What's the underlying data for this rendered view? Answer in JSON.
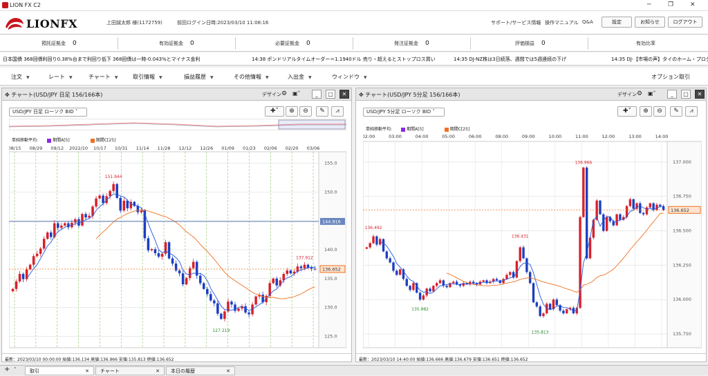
{
  "app": {
    "title": "LION FX C2",
    "brand": "LIONFX"
  },
  "header": {
    "user": "上田誠太郎 様(1172759)",
    "last_login": "前回ログイン日時:2023/03/10 11:08:16",
    "support": "サポート/サービス情報",
    "manual": "操作マニュアル",
    "qa": "Q&A",
    "settings": "設定",
    "notice": "お知らせ",
    "logout": "ログアウト"
  },
  "margin": {
    "items": [
      {
        "label": "預託証拠金",
        "value": "0"
      },
      {
        "label": "有効証拠金",
        "value": "0"
      },
      {
        "label": "必要証拠金",
        "value": "0"
      },
      {
        "label": "発注証拠金",
        "value": "0"
      },
      {
        "label": "評価損益",
        "value": "0"
      },
      {
        "label": "有効比率",
        "value": ""
      }
    ]
  },
  "ticker": {
    "items": [
      "日本国債 368回債利回り0.38%台まで利回り低下 368回債は一時-0.043%とマイナス金利",
      "14:38 ポンドリアルタイムオーダー＝1.1940ドル 売り・超えるとストップロス買い",
      "14:35 DJ-NZ株は3日続落、週間では5週連続の下げ",
      "14:35 DJ-【市場の声】タイのホーム・プロダク"
    ]
  },
  "menu": {
    "items": [
      "注文",
      "レート",
      "チャート",
      "取引情報",
      "損益履歴",
      "その他情報",
      "入出金",
      "ウィンドウ"
    ],
    "right": "オプション取引"
  },
  "chart_left": {
    "title": "チャート(USD/JPY 日足 156/166本)",
    "design": "デザイン",
    "symbol": "USD/JPY 日足 ローソク BID",
    "ma_label": "単純移動平均:",
    "ma_a": "期間A[5]",
    "ma_c": "期間C[25]",
    "footer": "最新：2023/03/10 00:00:00 始値:136.134 高値:136.966 安値:135.813 終値:136.652"
  },
  "chart_right": {
    "title": "チャート(USD/JPY 5分足 156/166本)",
    "design": "デザイン",
    "symbol": "USD/JPY 5分足 ローソク BID",
    "ma_label": "単純移動平均:",
    "ma_a": "期間A[5]",
    "ma_c": "期間C[25]",
    "footer": "最新：2023/03/10 14:40:00 始値:136.666 高値:136.679 安値:136.651 終値:136.652"
  },
  "bottom": {
    "tabs": [
      "取引",
      "チャート",
      "本日の履歴"
    ]
  },
  "colors": {
    "up": "#d8202a",
    "down": "#1c3fc0",
    "ma_a": "#8a2be2",
    "ma_c": "#f07020",
    "price_line": "#f07020"
  },
  "chart_data": [
    {
      "type": "candlestick",
      "title": "USD/JPY 日足",
      "x_ticks": [
        "08/15",
        "08/29",
        "09/12",
        "2022/10",
        "10/17",
        "10/31",
        "11/14",
        "11/28",
        "12/12",
        "12/26",
        "01/09",
        "01/23",
        "02/06",
        "02/20",
        "03/06"
      ],
      "y_ticks": [
        155.0,
        150.0,
        145.0,
        140.0,
        135.0,
        130.0,
        125.0
      ],
      "ylim": [
        123,
        157
      ],
      "current": 136.652,
      "crosshair": 144.916,
      "high_label": 151.944,
      "low_label": 127.219,
      "recent_high": 137.912,
      "close": [
        133.2,
        134.5,
        135.8,
        134.9,
        136.6,
        137.4,
        138.9,
        139.3,
        140.2,
        141.9,
        143.0,
        142.2,
        144.6,
        143.8,
        144.2,
        144.6,
        143.9,
        144.7,
        145.3,
        144.2,
        146.2,
        145.6,
        145.9,
        147.5,
        148.9,
        149.4,
        148.1,
        149.3,
        150.2,
        151.4,
        149.0,
        146.8,
        148.5,
        147.2,
        148.3,
        147.6,
        146.5,
        146.8,
        142.0,
        139.9,
        140.1,
        139.4,
        138.8,
        139.3,
        141.3,
        138.5,
        137.6,
        136.4,
        135.9,
        134.0,
        135.1,
        136.8,
        137.9,
        135.5,
        134.2,
        133.2,
        132.3,
        131.2,
        130.7,
        128.9,
        128.0,
        129.3,
        131.0,
        130.5,
        129.4,
        129.8,
        130.2,
        129.1,
        128.8,
        130.5,
        131.9,
        132.2,
        130.9,
        132.0,
        134.2,
        135.0,
        133.8,
        134.7,
        135.8,
        136.4,
        135.9,
        136.2,
        137.1,
        136.8,
        137.4,
        136.9,
        136.7,
        136.652
      ]
    },
    {
      "type": "candlestick",
      "title": "USD/JPY 5分足",
      "x_ticks": [
        "02:00",
        "03:00",
        "04:00",
        "05:00",
        "06:00",
        "08:00",
        "09:00",
        "10:00",
        "11:00",
        "12:00",
        "13:00",
        "14:00"
      ],
      "y_ticks": [
        137.0,
        136.75,
        136.5,
        136.25,
        136.0,
        135.75
      ],
      "ylim": [
        135.65,
        137.15
      ],
      "current": 136.652,
      "labels": {
        "high1": 136.492,
        "low1": 135.982,
        "high2": 136.431,
        "low2": 135.813,
        "high3": 136.966
      },
      "close": [
        136.38,
        136.41,
        136.46,
        136.4,
        136.44,
        136.35,
        136.3,
        136.27,
        136.21,
        136.18,
        136.22,
        136.15,
        136.1,
        136.07,
        136.12,
        136.05,
        136.0,
        136.03,
        136.08,
        136.06,
        136.1,
        136.12,
        136.14,
        136.1,
        136.09,
        136.12,
        136.13,
        136.11,
        136.1,
        136.12,
        136.11,
        136.13,
        136.12,
        136.11,
        136.13,
        136.14,
        136.12,
        136.13,
        136.15,
        136.14,
        136.12,
        136.15,
        136.18,
        136.2,
        136.16,
        136.28,
        136.38,
        136.3,
        136.2,
        136.12,
        135.98,
        135.95,
        135.88,
        135.9,
        135.97,
        135.93,
        136.0,
        135.96,
        135.92,
        135.9,
        135.93,
        135.94,
        135.9,
        135.94,
        136.6,
        136.96,
        136.3,
        136.45,
        136.58,
        136.72,
        136.62,
        136.5,
        136.6,
        136.57,
        136.54,
        136.62,
        136.58,
        136.6,
        136.68,
        136.73,
        136.66,
        136.7,
        136.63,
        136.62,
        136.67,
        136.7,
        136.65,
        136.69,
        136.68,
        136.652
      ]
    }
  ]
}
